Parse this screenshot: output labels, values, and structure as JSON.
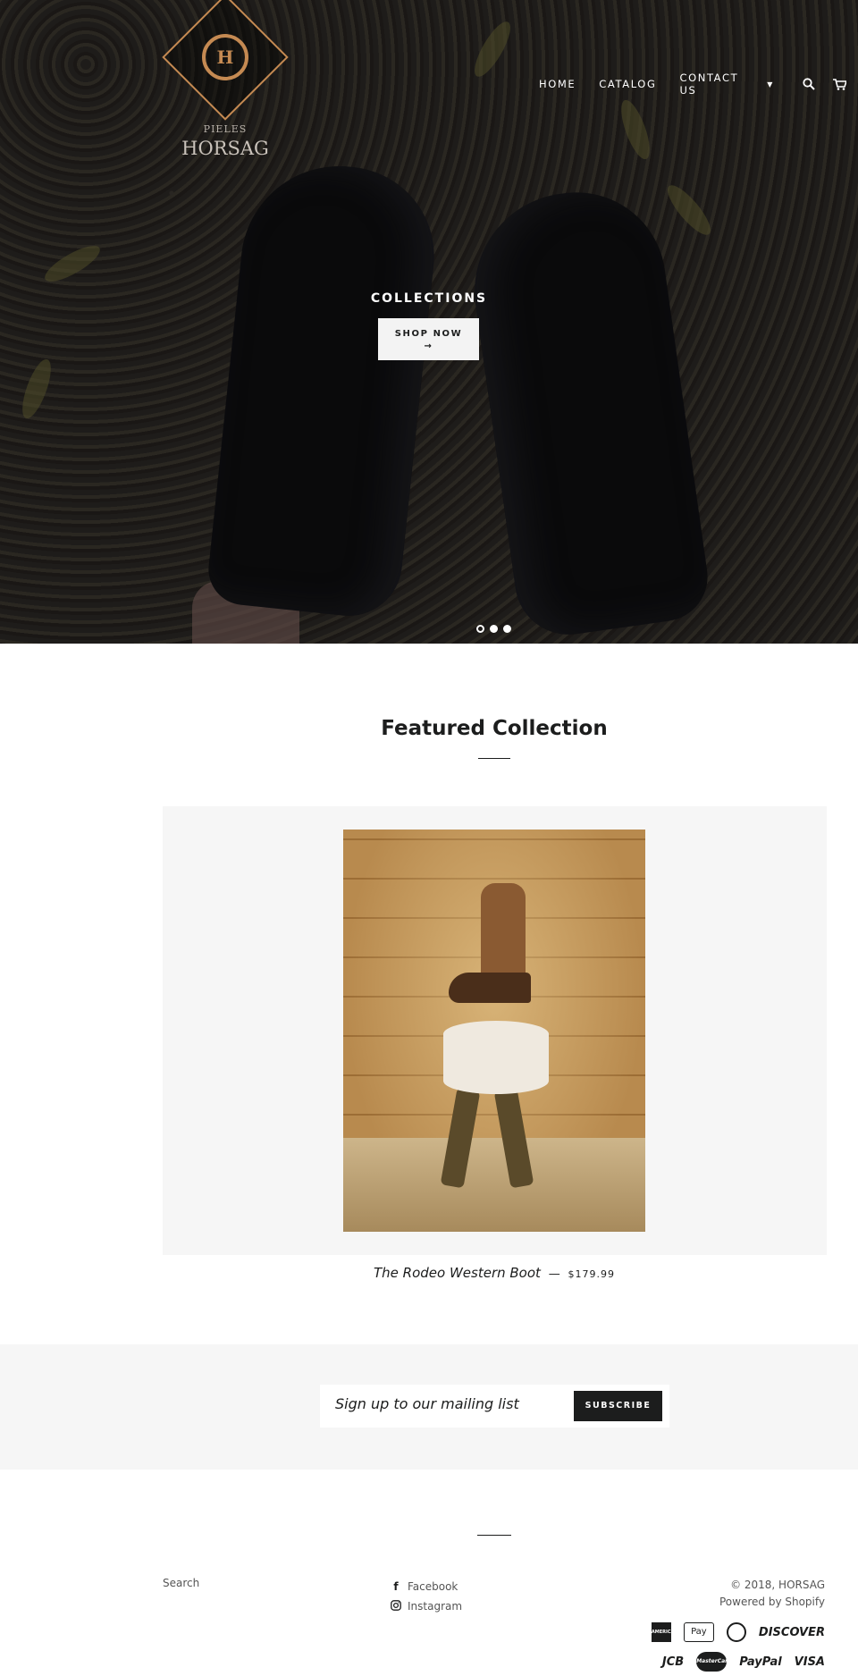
{
  "brand": {
    "logo_line1": "PIELES",
    "logo_line2": "HORSAG",
    "logo_mark": "H"
  },
  "nav": {
    "items": [
      {
        "label": "HOME"
      },
      {
        "label": "CATALOG"
      },
      {
        "label": "CONTACT US"
      }
    ],
    "icons": [
      "search-icon",
      "cart-icon"
    ]
  },
  "hero": {
    "title": "COLLECTIONS",
    "button_label": "SHOP NOW",
    "button_arrow": "→",
    "slides": 3,
    "active_slide": 1
  },
  "featured": {
    "title": "Featured Collection",
    "product": {
      "name": "The Rodeo Western Boot",
      "separator": "—",
      "price": "$179.99"
    }
  },
  "newsletter": {
    "placeholder": "Sign up to our mailing list",
    "button_label": "SUBSCRIBE"
  },
  "footer": {
    "search_link": "Search",
    "social": [
      {
        "icon": "facebook-icon",
        "label": "Facebook"
      },
      {
        "icon": "instagram-icon",
        "label": "Instagram"
      }
    ],
    "copyright": "© 2018, HORSAG",
    "powered": "Powered by Shopify",
    "payments_row1": [
      "AMERICAN EXPRESS",
      "Pay",
      "DISCOVER"
    ],
    "payments_row2": [
      "JCB",
      "MasterCard",
      "PayPal",
      "VISA"
    ]
  },
  "colors": {
    "accent_logo": "#c58a52",
    "dark": "#1c1d1d",
    "light_bg": "#f6f6f6"
  }
}
